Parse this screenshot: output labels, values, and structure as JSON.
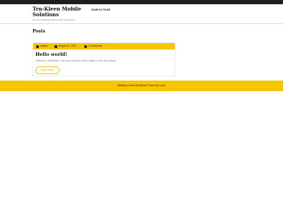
{
  "site": {
    "title": "Tru-Kleen Mobile Solutions",
    "tagline": "pressure washing, cleaning and maintenance"
  },
  "nav": {
    "items": [
      {
        "label": "SAMPLE PAGE"
      }
    ]
  },
  "main": {
    "heading": "Posts",
    "posts": [
      {
        "author": "adfadh",
        "date": "August 21, 2019",
        "comments": "0 Comments",
        "title": "Hello world!",
        "excerpt": "Welcome to WordPress. This is your first post. Edit or delete it, then start writing!",
        "read_more": "READ MORE"
      }
    ]
  },
  "footer": {
    "text": "Washing Center WordPress Theme By Luzuk"
  },
  "colors": {
    "accent": "#f7c500",
    "topbar": "#1f1f1f"
  },
  "icons": {
    "author": "user-icon",
    "date": "calendar-icon",
    "comments": "comment-icon"
  }
}
